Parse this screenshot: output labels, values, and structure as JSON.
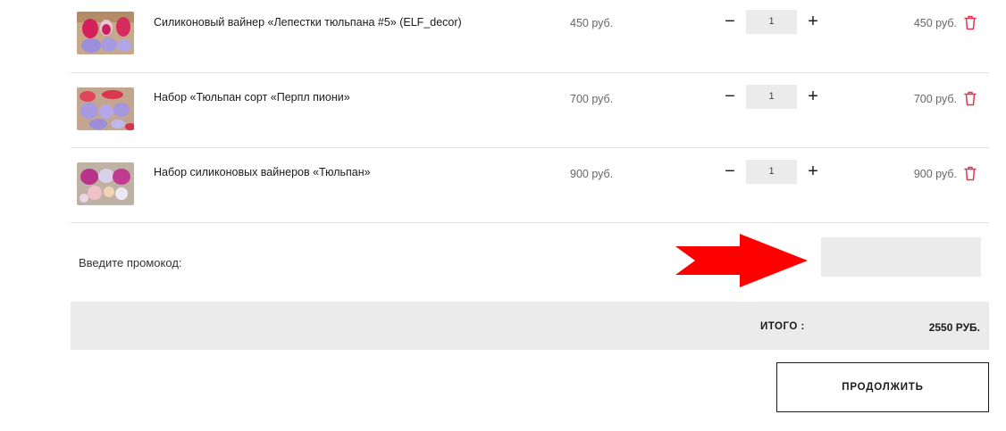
{
  "colors": {
    "accent": "#ff0000",
    "trash": "#e8334f",
    "panel_bg": "#ebebeb",
    "text": "#1b1b1b"
  },
  "cart": {
    "items": [
      {
        "name": "Силиконовый вайнер «Лепестки тюльпана #5» (ELF_decor)",
        "price": "450 руб.",
        "quantity": "1",
        "sum": "450 руб.",
        "remove_icon": "trash-icon"
      },
      {
        "name": "Набор «Тюльпан сорт «Перпл пиони»",
        "price": "700 руб.",
        "quantity": "1",
        "sum": "700 руб.",
        "remove_icon": "trash-icon"
      },
      {
        "name": "Набор силиконовых вайнеров «Тюльпан»",
        "price": "900 руб.",
        "quantity": "1",
        "sum": "900 руб.",
        "remove_icon": "trash-icon"
      }
    ],
    "minus_label": "−",
    "plus_label": "+"
  },
  "promo": {
    "label": "Введите промокод:",
    "value": "",
    "arrow_icon": "right-arrow-icon"
  },
  "total": {
    "label": "ИТОГО :",
    "value": "2550 РУБ."
  },
  "actions": {
    "continue_label": "ПРОДОЛЖИТЬ"
  }
}
